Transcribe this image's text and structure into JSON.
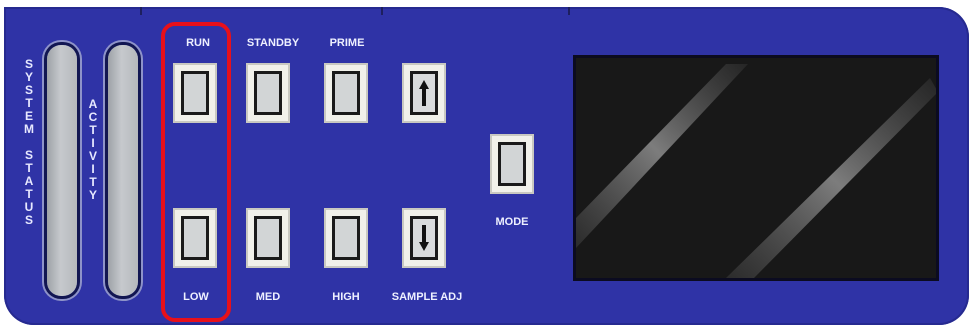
{
  "panel": {
    "system_status_label": [
      "S",
      "Y",
      "S",
      "T",
      "E",
      "M",
      "",
      "S",
      "T",
      "A",
      "T",
      "U",
      "S"
    ],
    "activity_label": [
      "A",
      "C",
      "T",
      "I",
      "V",
      "I",
      "T",
      "Y"
    ]
  },
  "buttons": {
    "run": "RUN",
    "standby": "STANDBY",
    "prime": "PRIME",
    "low": "LOW",
    "med": "MED",
    "high": "HIGH",
    "sample_adj": "SAMPLE ADJ",
    "mode": "MODE"
  },
  "icons": {
    "up": "up-arrow-icon",
    "down": "down-arrow-icon"
  },
  "colors": {
    "panel": "#2f33a6",
    "highlight": "#e8101a",
    "display": "#181818"
  }
}
